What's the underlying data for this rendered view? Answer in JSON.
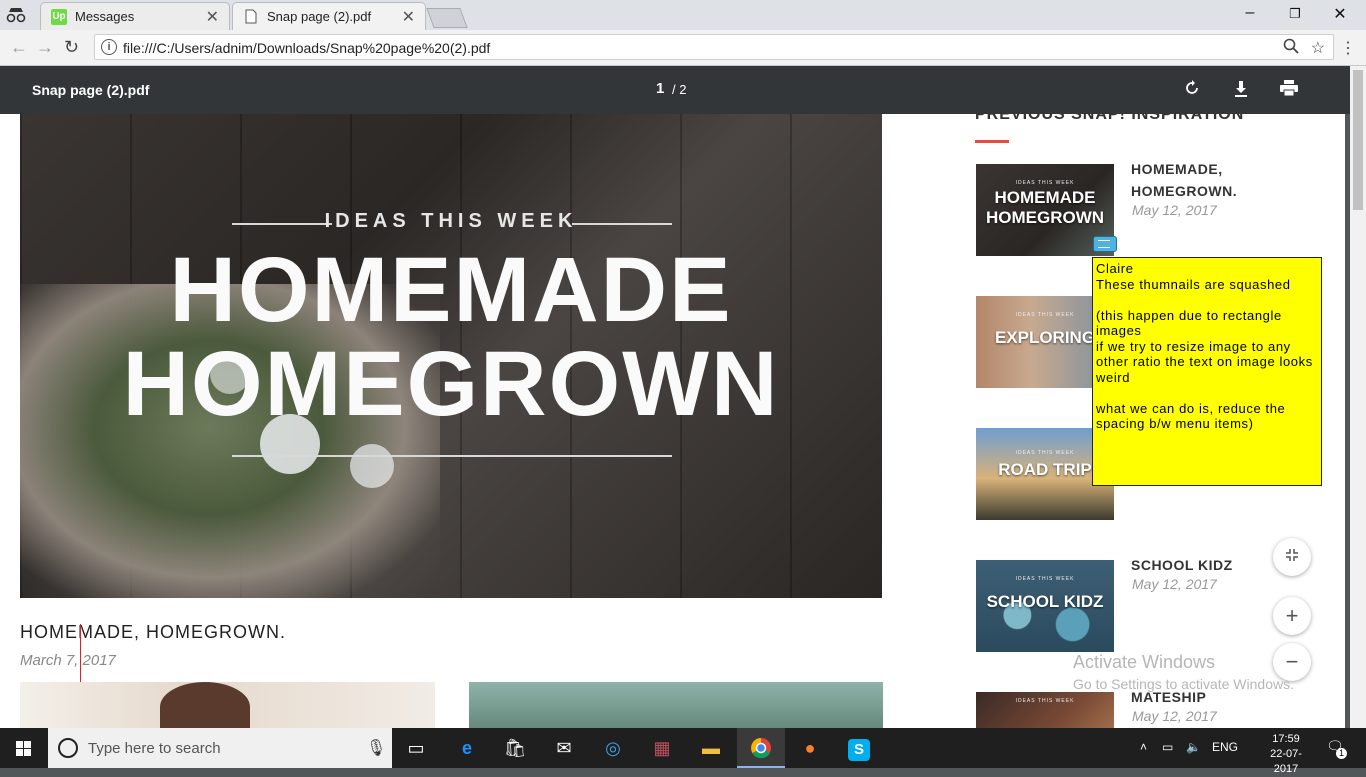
{
  "browser": {
    "tabs": [
      {
        "label": "Messages",
        "icon": "upwork-icon",
        "active": false
      },
      {
        "label": "Snap page (2).pdf",
        "icon": "document-icon",
        "active": true
      }
    ],
    "url": "file:///C:/Users/adnim/Downloads/Snap%20page%20(2).pdf"
  },
  "pdf": {
    "title": "Snap page (2).pdf",
    "current_page": "1",
    "separator_total": "/ 2"
  },
  "page": {
    "hero": {
      "kicker": "IDEAS THIS WEEK",
      "line1": "HOMEMADE",
      "line2": "HOMEGROWN"
    },
    "post_title": "HOMEMADE, HOMEGROWN.",
    "post_date": "March 7, 2017",
    "sidebar": {
      "heading": "PREVIOUS SNAP! INSPIRATION",
      "cards": [
        {
          "image_text_1": "HOMEMADE",
          "image_text_2": "HOMEGROWN",
          "title": "HOMEMADE, HOMEGROWN.",
          "date": "May 12, 2017"
        },
        {
          "image_text_1": "EXPLORING",
          "title": "",
          "date": ""
        },
        {
          "image_text_1": "ROAD TRIP",
          "title": "",
          "date": ""
        },
        {
          "image_text_1": "SCHOOL KIDZ",
          "title": "SCHOOL KIDZ",
          "date": "May 12, 2017"
        },
        {
          "image_text_1": "",
          "title": "MATESHIP",
          "date": "May 12, 2017"
        }
      ],
      "image_kicker": "IDEAS THIS WEEK"
    },
    "comment": {
      "author": "Claire",
      "lines": [
        "These thumnails are squashed",
        "",
        "(this happen due to rectangle images",
        "if we try to resize image to any other ratio the text on image looks weird",
        "",
        "what we can do is, reduce the spacing b/w menu items)"
      ]
    },
    "watermark": {
      "line1": "Activate Windows",
      "line2": "Go to Settings to activate Windows."
    }
  },
  "taskbar": {
    "search_placeholder": "Type here to search",
    "language": "ENG",
    "time": "17:59",
    "date": "22-07-2017",
    "notification_count": "1"
  }
}
